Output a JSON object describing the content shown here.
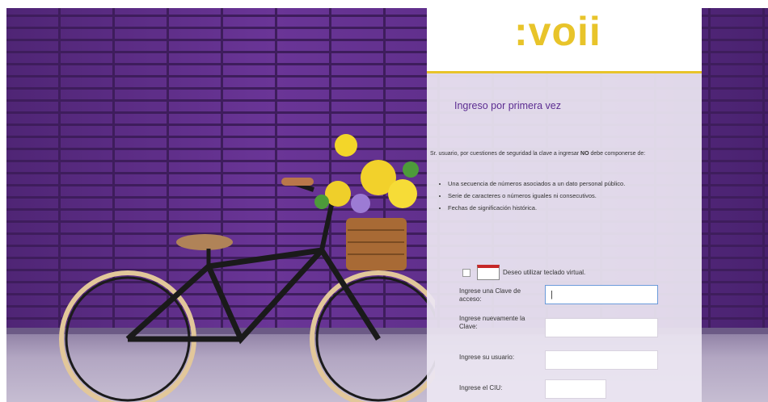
{
  "brand": {
    "logo": ":voii",
    "accent": "#e8c42a",
    "primary": "#5c2d91"
  },
  "form": {
    "title": "Ingreso por primera vez",
    "intro_prefix": "Sr. usuario, por cuestiones de seguridad la clave a ingresar",
    "intro_bold": "NO",
    "intro_suffix": "debe componerse de:",
    "rules": [
      "Una secuencia de números asociados a un dato personal público.",
      "Serie de caracteres o números iguales ni consecutivos.",
      "Fechas de significación histórica."
    ],
    "virtual_keyboard_label": "Deseo utilizar teclado virtual.",
    "fields": {
      "password_label": "Ingrese una Clave de acceso:",
      "password_value": "|",
      "password_confirm_label": "Ingrese nuevamente la Clave:",
      "username_label": "Ingrese su usuario:",
      "ciu_label": "Ingrese el CIU:"
    }
  }
}
